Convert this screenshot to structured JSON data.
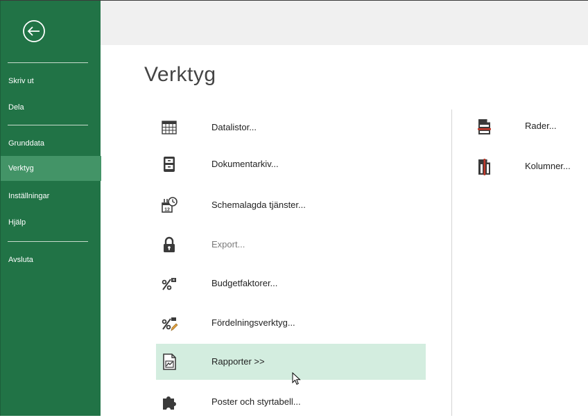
{
  "sidebar": {
    "back_icon": "back-arrow-icon",
    "items": [
      {
        "label": "Skriv ut"
      },
      {
        "label": "Dela"
      },
      {
        "label": "Grunddata"
      },
      {
        "label": "Verktyg",
        "active": true
      },
      {
        "label": "Inställningar"
      },
      {
        "label": "Hjälp"
      },
      {
        "label": "Avsluta"
      }
    ]
  },
  "main": {
    "title": "Verktyg",
    "tools": [
      {
        "label": "Datalistor...",
        "icon": "grid-table-icon"
      },
      {
        "label": "Dokumentarkiv...",
        "icon": "archive-cabinet-icon"
      },
      {
        "label": "Schemalagda tjänster...",
        "icon": "calendar-clock-icon"
      },
      {
        "label": "Export...",
        "icon": "padlock-icon",
        "disabled": true
      },
      {
        "label": "Budgetfaktorer...",
        "icon": "percent-factor-icon"
      },
      {
        "label": "Fördelningsverktyg...",
        "icon": "percent-pencil-icon"
      },
      {
        "label": "Rapporter >>",
        "icon": "report-chart-icon",
        "selected": true
      },
      {
        "label": "Poster och styrtabell...",
        "icon": "puzzle-piece-icon"
      }
    ],
    "right_tools": [
      {
        "label": "Rader...",
        "icon": "rows-document-icon"
      },
      {
        "label": "Kolumner...",
        "icon": "columns-document-icon"
      }
    ]
  },
  "colors": {
    "sidebar_bg": "#217346",
    "sidebar_active": "#439467",
    "selection_bg": "#d3eddf",
    "icon_dark": "#3a3a3a",
    "accent_red": "#c0392b"
  }
}
